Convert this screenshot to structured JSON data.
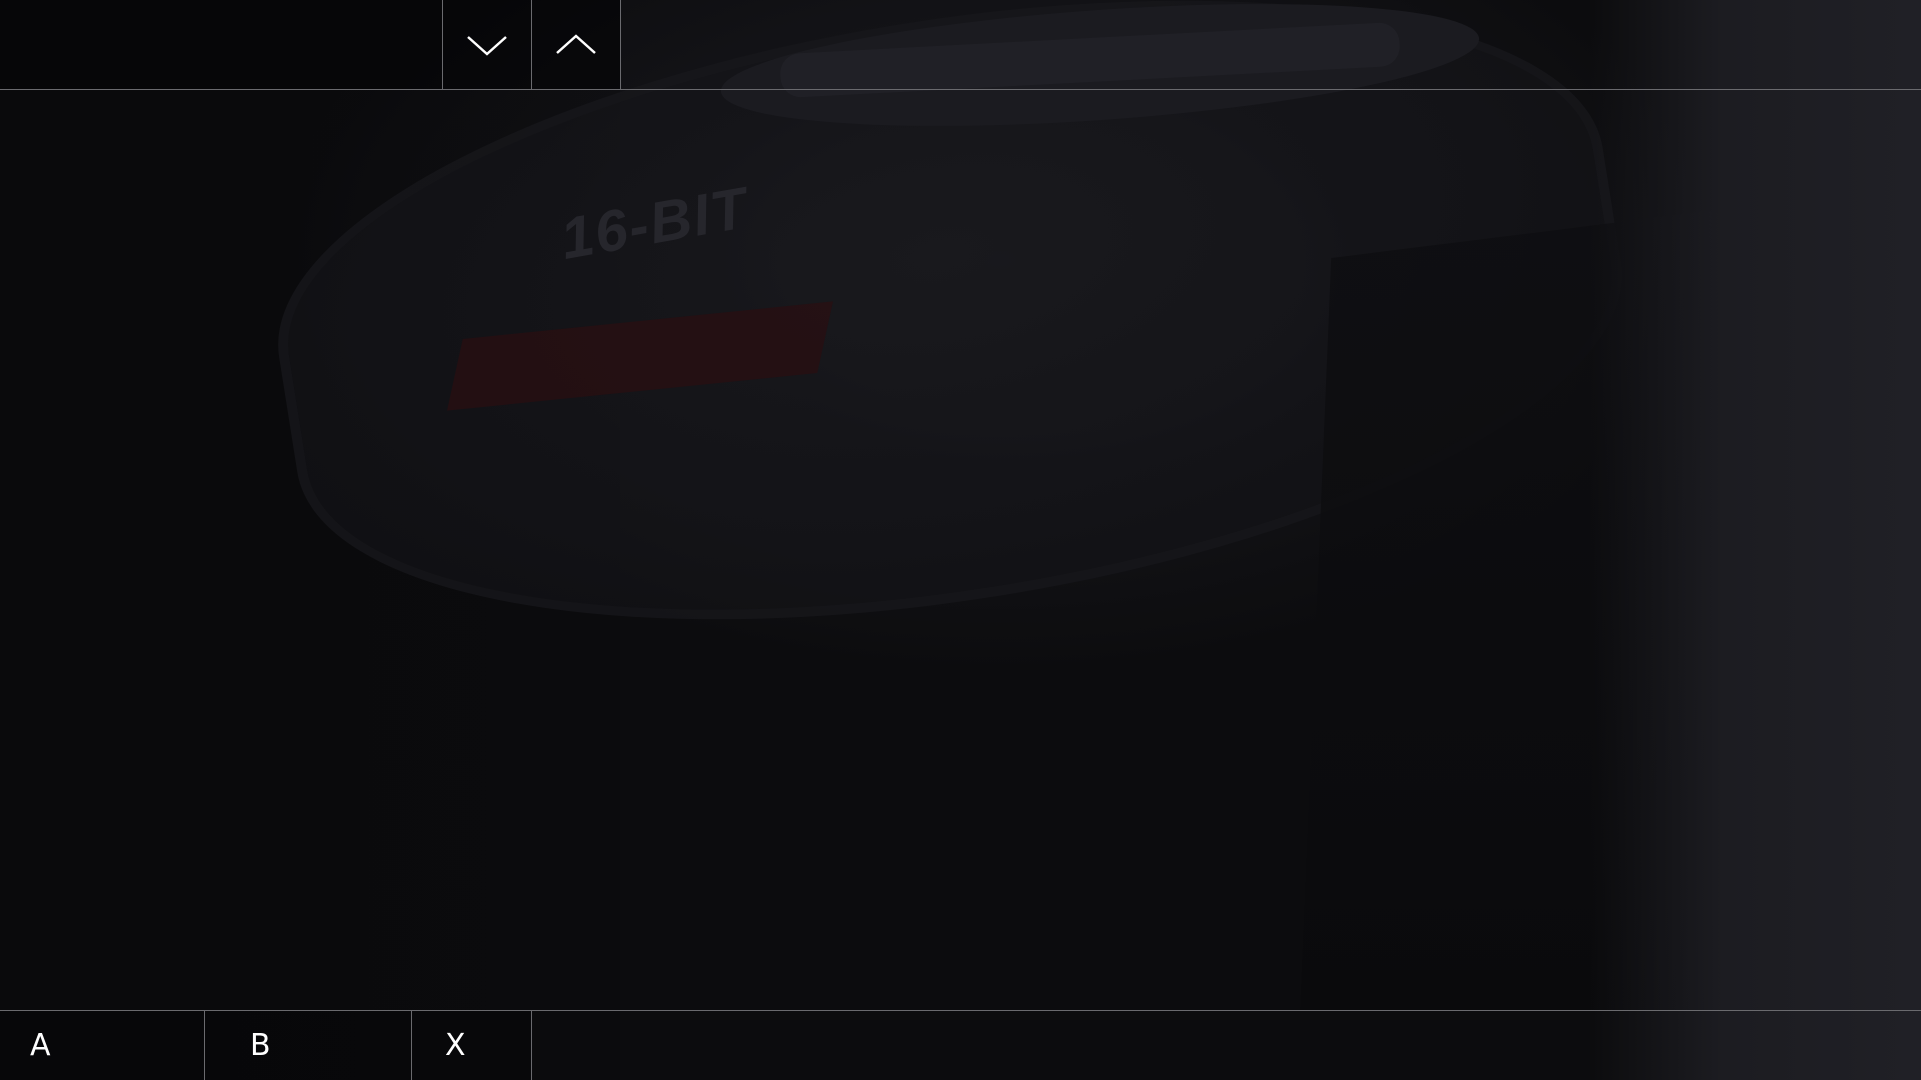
{
  "topbar": {
    "title": "",
    "nav_down_icon": "chevron-down-icon",
    "nav_up_icon": "chevron-up-icon"
  },
  "scene": {
    "console_text": "16-BIT"
  },
  "actions": [
    {
      "label": "A"
    },
    {
      "label": "B"
    },
    {
      "label": "X"
    }
  ],
  "colors": {
    "divider": "#6a6a6e",
    "text": "#ffffff",
    "background": "#0c0c0e"
  }
}
